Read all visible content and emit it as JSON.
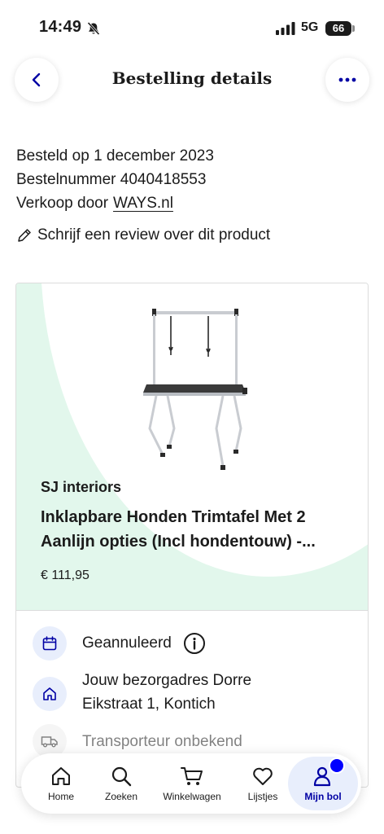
{
  "status_bar": {
    "time": "14:49",
    "network": "5G",
    "battery": "66"
  },
  "header": {
    "title": "Bestelling details"
  },
  "order": {
    "date_line": "Besteld op 1 december 2023",
    "number_line": "Bestelnummer 4040418553",
    "sold_by_prefix": "Verkoop door",
    "seller": "WAYS.nl",
    "review_link": "Schrijf een review over dit product"
  },
  "product": {
    "brand": "SJ interiors",
    "name": "Inklapbare Honden Trimtafel Met 2 Aanlijn opties (Incl hondentouw) -...",
    "price": "€ 111,95"
  },
  "details": {
    "status": "Geannuleerd",
    "address_line1": "Jouw bezorgadres Dorre",
    "address_line2": "Eikstraat 1, Kontich",
    "carrier": "Transporteur onbekend"
  },
  "nav": {
    "items": [
      {
        "label": "Home",
        "icon": "home-icon"
      },
      {
        "label": "Zoeken",
        "icon": "search-icon"
      },
      {
        "label": "Winkelwagen",
        "icon": "cart-icon"
      },
      {
        "label": "Lijstjes",
        "icon": "heart-icon"
      },
      {
        "label": "Mijn bol",
        "icon": "user-icon"
      }
    ]
  },
  "colors": {
    "brand_blue": "#0000a4",
    "notification": "#0000ff",
    "hero_green": "#e2f7ec",
    "icon_bg": "#e8eefc"
  }
}
